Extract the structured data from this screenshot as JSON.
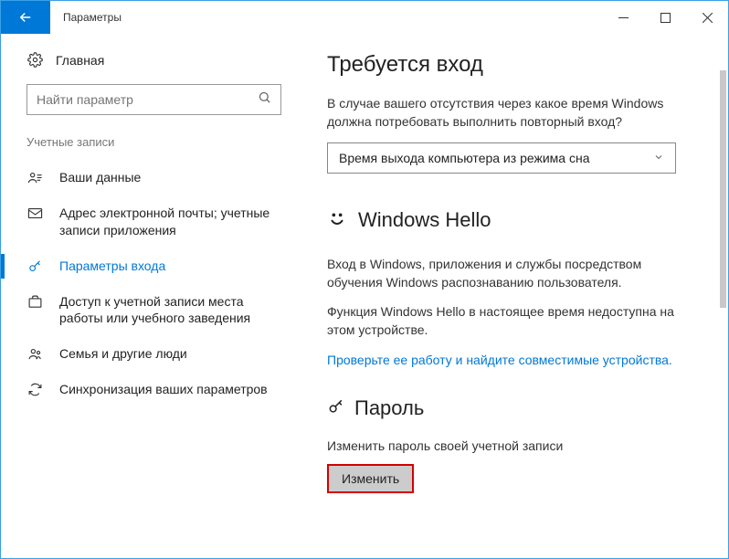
{
  "titlebar": {
    "title": "Параметры"
  },
  "sidebar": {
    "home": "Главная",
    "search_placeholder": "Найти параметр",
    "section": "Учетные записи",
    "items": [
      {
        "label": "Ваши данные"
      },
      {
        "label": "Адрес электронной почты; учетные записи приложения"
      },
      {
        "label": "Параметры входа"
      },
      {
        "label": "Доступ к учетной записи места работы или учебного заведения"
      },
      {
        "label": "Семья и другие люди"
      },
      {
        "label": "Синхронизация ваших параметров"
      }
    ]
  },
  "content": {
    "signin_heading": "Требуется вход",
    "signin_desc": "В случае вашего отсутствия через какое время Windows должна потребовать выполнить повторный вход?",
    "dropdown_value": "Время выхода компьютера из режима сна",
    "hello_heading": "Windows Hello",
    "hello_p1": "Вход в Windows, приложения и службы посредством обучения Windows распознаванию пользователя.",
    "hello_p2": "Функция Windows Hello в настоящее время недоступна на этом устройстве.",
    "hello_link": "Проверьте ее работу и найдите совместимые устройства.",
    "password_heading": "Пароль",
    "password_desc": "Изменить пароль своей учетной записи",
    "change_button": "Изменить"
  }
}
